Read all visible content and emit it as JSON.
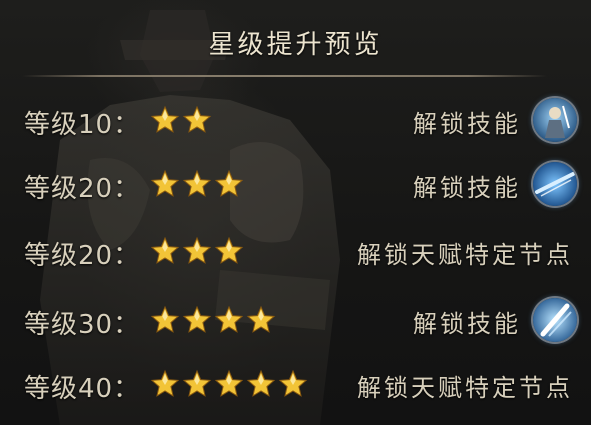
{
  "title": "星级提升预览",
  "rows": [
    {
      "level_label": "等级10：",
      "stars": 2,
      "reward": "解锁技能",
      "icon": "skill-icon-swordsman",
      "wide": false
    },
    {
      "level_label": "等级20：",
      "stars": 3,
      "reward": "解锁技能",
      "icon": "skill-icon-lance-charge",
      "wide": false
    },
    {
      "level_label": "等级20：",
      "stars": 3,
      "reward": "解锁天赋特定节点",
      "icon": null,
      "wide": true
    },
    {
      "level_label": "等级30：",
      "stars": 4,
      "reward": "解锁技能",
      "icon": "skill-icon-blade-strike",
      "wide": false
    },
    {
      "level_label": "等级40：",
      "stars": 5,
      "reward": "解锁天赋特定节点",
      "icon": null,
      "wide": true
    }
  ],
  "colors": {
    "star_gold": "#f2c437",
    "text": "#d8d0bc",
    "title": "#ece4cf"
  }
}
